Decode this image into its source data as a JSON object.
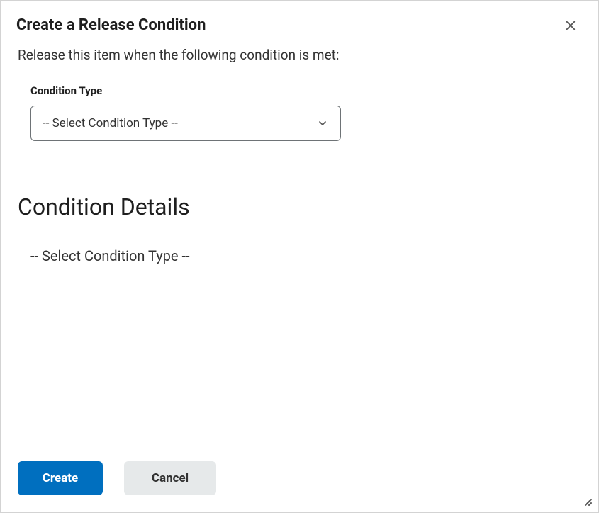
{
  "dialog": {
    "title": "Create a Release Condition",
    "instruction": "Release this item when the following condition is met:"
  },
  "conditionType": {
    "label": "Condition Type",
    "selected": "-- Select Condition Type --"
  },
  "detailsSection": {
    "heading": "Condition Details",
    "placeholder": "-- Select Condition Type --"
  },
  "footer": {
    "createLabel": "Create",
    "cancelLabel": "Cancel"
  }
}
